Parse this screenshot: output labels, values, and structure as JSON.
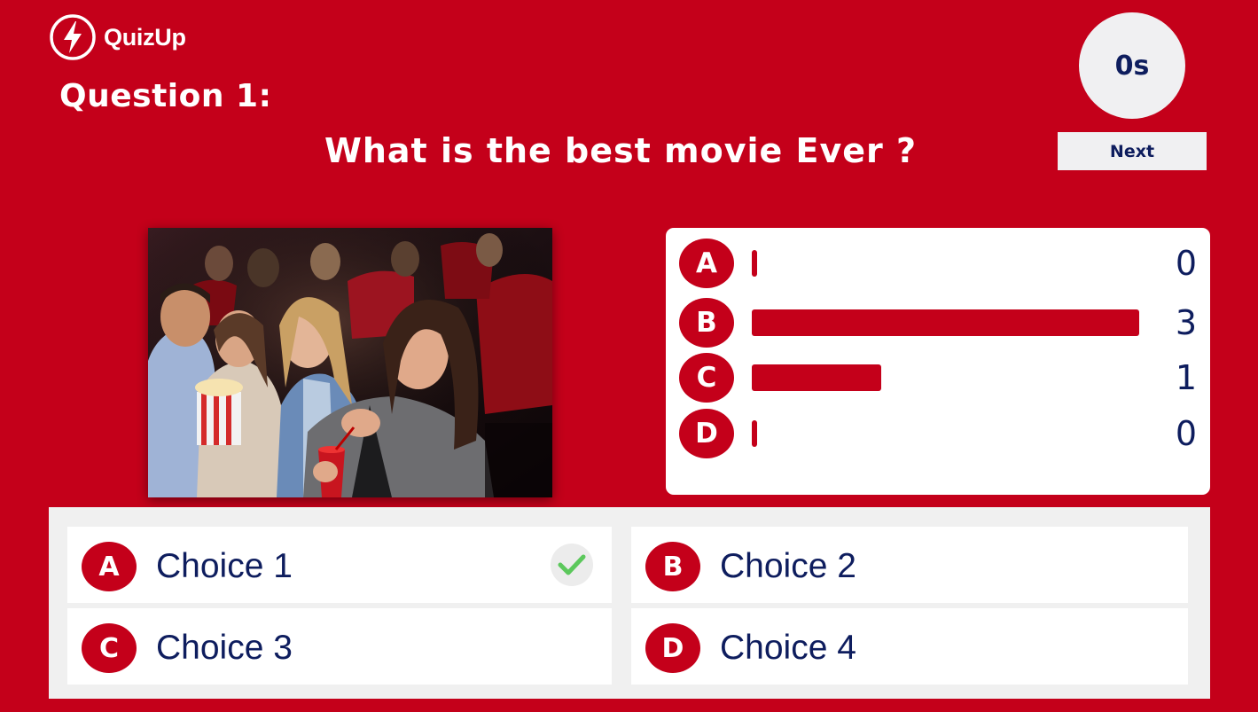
{
  "app": {
    "logo_text": "QuizUp",
    "logo_icon": "lightning-bolt-icon"
  },
  "question": {
    "number_label": "Question 1:",
    "text": "What is the best movie Ever ?"
  },
  "timer": {
    "label": "0s"
  },
  "controls": {
    "next_label": "Next"
  },
  "image": {
    "subject": "audience-in-cinema-photo"
  },
  "results": {
    "bars": [
      {
        "letter": "A",
        "count": "0",
        "value": 0
      },
      {
        "letter": "B",
        "count": "3",
        "value": 3
      },
      {
        "letter": "C",
        "count": "1",
        "value": 1
      },
      {
        "letter": "D",
        "count": "0",
        "value": 0
      }
    ]
  },
  "choices": [
    {
      "letter": "A",
      "label": "Choice 1",
      "correct": true
    },
    {
      "letter": "B",
      "label": "Choice 2",
      "correct": false
    },
    {
      "letter": "C",
      "label": "Choice 3",
      "correct": false
    },
    {
      "letter": "D",
      "label": "Choice 4",
      "correct": false
    }
  ],
  "colors": {
    "brand_red": "#C4001A",
    "text_navy": "#0E1D5E",
    "panel_light": "#F0F0F0",
    "correct_green": "#5CC85C"
  }
}
